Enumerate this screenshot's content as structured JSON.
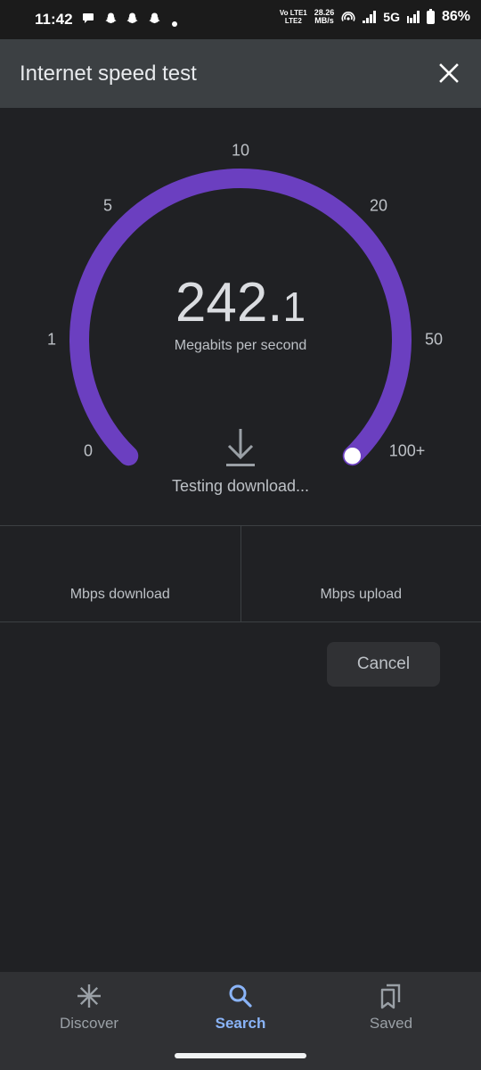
{
  "status_bar": {
    "time": "11:42",
    "notification_icons": [
      "chat-bubble-icon",
      "snapchat-icon",
      "snapchat-icon",
      "snapchat-icon",
      "dot-icon"
    ],
    "volte_top": "Vo LTE1",
    "volte_bottom": "LTE2",
    "net_speed_value": "28.26",
    "net_speed_unit": "MB/s",
    "network_type": "5G",
    "battery": "86%"
  },
  "header": {
    "title": "Internet speed test",
    "close_icon": "close-icon"
  },
  "gauge": {
    "accent_color": "#6b3fc0",
    "ticks": [
      "0",
      "1",
      "5",
      "10",
      "20",
      "50",
      "100+"
    ],
    "speed_integer": "242.",
    "speed_decimal": "1",
    "units": "Megabits per second",
    "progress_fraction": 1.0,
    "status_icon": "download-icon",
    "status_text": "Testing download..."
  },
  "results": {
    "download_value": "",
    "download_label": "Mbps download",
    "upload_value": "",
    "upload_label": "Mbps upload"
  },
  "actions": {
    "cancel_label": "Cancel"
  },
  "bottom_nav": {
    "active_color": "#8ab4f8",
    "items": [
      {
        "label": "Discover",
        "icon": "asterisk-icon"
      },
      {
        "label": "Search",
        "icon": "search-icon"
      },
      {
        "label": "Saved",
        "icon": "bookmarks-icon"
      }
    ],
    "active_index": 1
  }
}
